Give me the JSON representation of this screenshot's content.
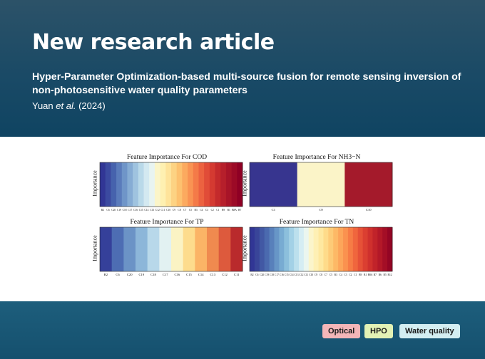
{
  "header": {
    "headline": "New research article",
    "article_title": "Hyper-Parameter Optimization-based multi-source fusion for remote sensing inversion of non-photosensitive water quality parameters",
    "citation_author": "Yuan ",
    "citation_etal": "et al.",
    "citation_year": " (2024)"
  },
  "chart_data": [
    {
      "type": "heatmap",
      "title": "Feature Importance For COD",
      "ylabel": "Importance",
      "categories": [
        "B2",
        "C6",
        "C20",
        "C19",
        "C18",
        "C17",
        "C16",
        "C15",
        "C14",
        "C13",
        "C12",
        "C11",
        "C10",
        "C9",
        "C8",
        "C7",
        "C5",
        "B3",
        "C4",
        "C3",
        "C2",
        "C1",
        "B9",
        "B1",
        "B8A",
        "B7"
      ],
      "colors": [
        "#313695",
        "#3b4aa0",
        "#4662ad",
        "#5a7bbb",
        "#6f95c8",
        "#86acd4",
        "#9fc3df",
        "#b9d9e9",
        "#d3e9f1",
        "#e8f4f1",
        "#fbf5c8",
        "#fef0b1",
        "#fee39a",
        "#fdd383",
        "#fdc16f",
        "#fcaa5f",
        "#f99353",
        "#f47a48",
        "#ec6240",
        "#e14c38",
        "#d43a31",
        "#c42a2c",
        "#b61f2b",
        "#a81428",
        "#9c0a26",
        "#8f0024"
      ]
    },
    {
      "type": "heatmap",
      "title": "Feature Importance For NH3−N",
      "ylabel": "Importance",
      "categories": [
        "C1",
        "C9",
        "C10"
      ],
      "colors": [
        "#37358f",
        "#fbf4c8",
        "#a41a2b"
      ]
    },
    {
      "type": "heatmap",
      "title": "Feature Importance For TP",
      "ylabel": "Importance",
      "categories": [
        "B2",
        "C6",
        "C20",
        "C19",
        "C18",
        "C17",
        "C16",
        "C15",
        "C14",
        "C13",
        "C12",
        "C11"
      ],
      "colors": [
        "#35409a",
        "#4d6db3",
        "#6b93c6",
        "#8cb6d9",
        "#b8d8ea",
        "#e2f1f2",
        "#fbf3c4",
        "#fddc8d",
        "#fbb466",
        "#f08a4f",
        "#dd5a3d",
        "#b92a2c"
      ]
    },
    {
      "type": "heatmap",
      "title": "Feature Importance For TN",
      "ylabel": "Importance",
      "categories": [
        "B2",
        "C6",
        "C20",
        "C19",
        "C18",
        "C17",
        "C16",
        "C15",
        "C14",
        "C13",
        "C12",
        "C11",
        "C10",
        "C9",
        "C8",
        "C7",
        "C5",
        "B3",
        "C4",
        "C3",
        "C2",
        "C1",
        "B9",
        "B1",
        "B8A",
        "B7",
        "B6",
        "B5",
        "B12"
      ],
      "colors": [
        "#313695",
        "#394599",
        "#4258a4",
        "#4b6aaf",
        "#5880bb",
        "#6796c7",
        "#78abd2",
        "#8cbfdc",
        "#a3d1e6",
        "#bce0ed",
        "#d5edf3",
        "#ebf6ef",
        "#fbf5cb",
        "#fef0b4",
        "#fee8a0",
        "#fedb8a",
        "#fdcb77",
        "#fdb966",
        "#fca65a",
        "#fa924f",
        "#f67c45",
        "#f0663d",
        "#e65137",
        "#db3f31",
        "#cf302d",
        "#c1232a",
        "#b31828",
        "#a40e26",
        "#940524"
      ]
    }
  ],
  "tags": [
    {
      "label": "Optical",
      "color": "#f4b6b8"
    },
    {
      "label": "HPO",
      "color": "#e3f2b5"
    },
    {
      "label": "Water quality",
      "color": "#d4eef2"
    }
  ]
}
